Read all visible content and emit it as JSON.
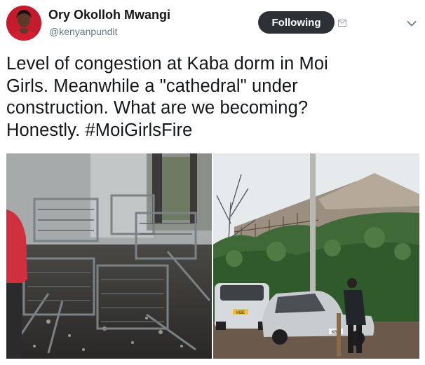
{
  "author": {
    "name": "Ory Okolloh Mwangi",
    "handle": "@kenyanpundit",
    "avatar_icon": "profile-photo"
  },
  "follow_button": {
    "label": "Following"
  },
  "icons": {
    "dm": "envelope-icon",
    "menu": "chevron-down-icon"
  },
  "tweet": {
    "line1": "Level of congestion at Kaba dorm in Moi",
    "line2": "Girls.  Meanwhile a \"cathedral\" under",
    "line3": "construction.  What are we becoming?",
    "line4": "Honestly. #MoiGirlsFire"
  },
  "media": {
    "left_photo": "burned-dorm-photo",
    "right_photo": "cathedral-construction-photo",
    "plate_1": "KBE",
    "plate_2": "KBU"
  },
  "colors": {
    "follow_bg": "#2d3136",
    "text": "#14171a",
    "muted": "#657786"
  }
}
